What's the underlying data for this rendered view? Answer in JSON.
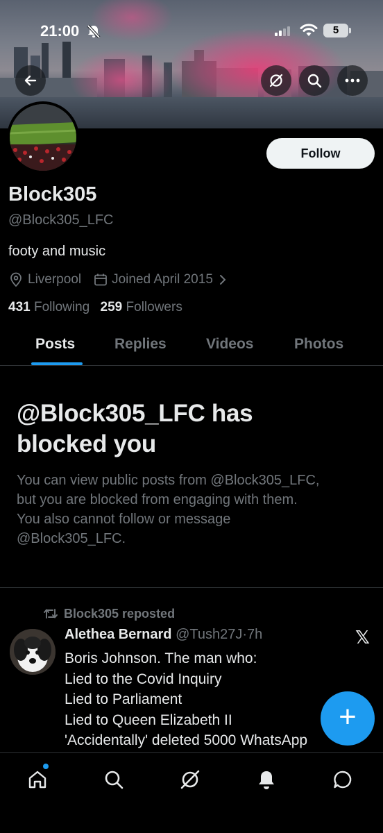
{
  "status_bar": {
    "time": "21:00",
    "battery": "5",
    "icons": [
      "bell-off-icon",
      "signal-icon",
      "wifi-icon",
      "battery-icon"
    ]
  },
  "header": {
    "buttons": [
      "back-arrow-icon",
      "grok-icon",
      "search-icon",
      "more-icon"
    ]
  },
  "profile": {
    "follow_label": "Follow",
    "display_name": "Block305",
    "handle": "@Block305_LFC",
    "bio": "footy and music",
    "location": "Liverpool",
    "joined": "Joined April 2015",
    "following_count": "431",
    "following_label": "Following",
    "followers_count": "259",
    "followers_label": "Followers"
  },
  "tabs": [
    {
      "label": "Posts",
      "active": true
    },
    {
      "label": "Replies",
      "active": false
    },
    {
      "label": "Videos",
      "active": false
    },
    {
      "label": "Photos",
      "active": false
    }
  ],
  "blocked": {
    "title_line1": "@Block305_LFC has",
    "title_line2": "blocked you",
    "desc_line1": "You can view public posts from @Block305_LFC,",
    "desc_line2": "but you are blocked from engaging with them.",
    "desc_line3": "You also cannot follow or message",
    "desc_line4": "@Block305_LFC."
  },
  "post": {
    "repost_label": "Block305 reposted",
    "author": "Alethea Bernard",
    "author_handle": "@Tush27J",
    "separator": "·",
    "time": "7h",
    "lines": [
      "Boris Johnson. The man who:",
      "Lied to the Covid Inquiry",
      "Lied to Parliament",
      "Lied to Queen Elizabeth II",
      "'Accidentally' deleted 5000 WhatsApp"
    ]
  },
  "fab": {
    "label": "+"
  },
  "bottom_nav": [
    "home-icon",
    "search-icon",
    "grok-icon",
    "notifications-icon",
    "messages-icon"
  ],
  "colors": {
    "accent": "#1d9bf0",
    "background": "#000000",
    "muted": "#71767b",
    "text": "#e7e9ea"
  }
}
